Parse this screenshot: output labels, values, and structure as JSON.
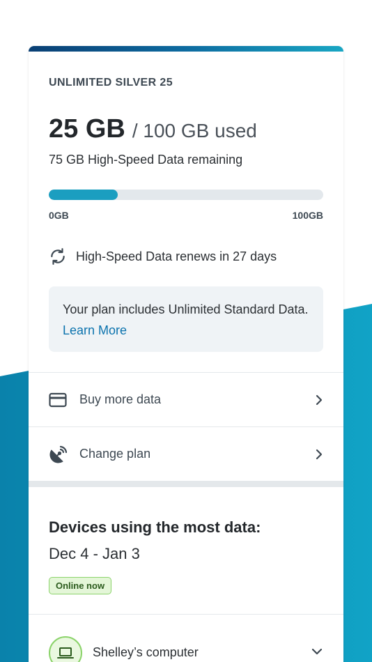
{
  "plan": {
    "name": "UNLIMITED SILVER 25",
    "used_amount": "25 GB",
    "total_text": "/ 100 GB used",
    "remaining_text": "75 GB High-Speed Data remaining",
    "usage_fraction": 0.25,
    "scale_min": "0GB",
    "scale_max": "100GB",
    "renews_text": "High-Speed Data renews in 27 days"
  },
  "info_box": {
    "text": "Your plan includes Unlimited Standard Data.",
    "link_text": "Learn More"
  },
  "actions": [
    {
      "label": "Buy more data",
      "icon": "credit-card-icon"
    },
    {
      "label": "Change plan",
      "icon": "satellite-dish-icon"
    }
  ],
  "devices": {
    "title": "Devices using the most data:",
    "date_range": "Dec 4 - Jan 3",
    "badge": "Online now",
    "items": [
      {
        "name": "Shelley’s computer",
        "icon": "laptop-icon"
      }
    ]
  },
  "colors": {
    "accent": "#1b9ec0",
    "link": "#0a72ad",
    "wave": "#0d93b8",
    "badge_border": "#8bd36a"
  }
}
